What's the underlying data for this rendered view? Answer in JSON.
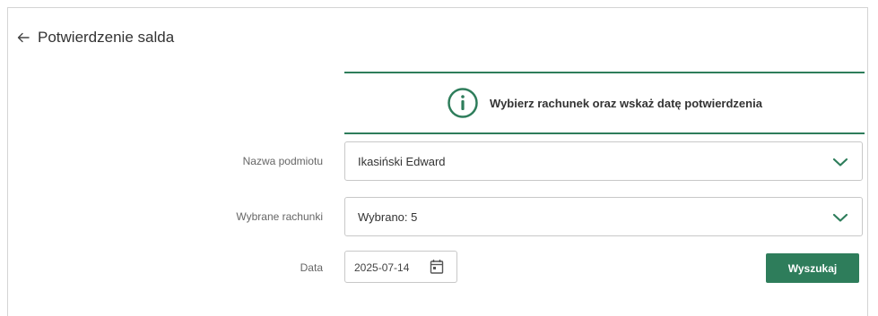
{
  "header": {
    "title": "Potwierdzenie salda"
  },
  "info": {
    "message": "Wybierz rachunek oraz wskaż datę potwierdzenia"
  },
  "form": {
    "entity": {
      "label": "Nazwa podmiotu",
      "value": "Ikasiński Edward"
    },
    "accounts": {
      "label": "Wybrane rachunki",
      "value": "Wybrano: 5"
    },
    "date": {
      "label": "Data",
      "value": "2025-07-14"
    },
    "search_label": "Wyszukaj"
  },
  "colors": {
    "accent": "#2e7d5b"
  },
  "icons": {
    "back": "arrow-left-icon",
    "info": "info-circle-icon",
    "dropdown": "chevron-down-icon",
    "calendar": "calendar-icon"
  }
}
